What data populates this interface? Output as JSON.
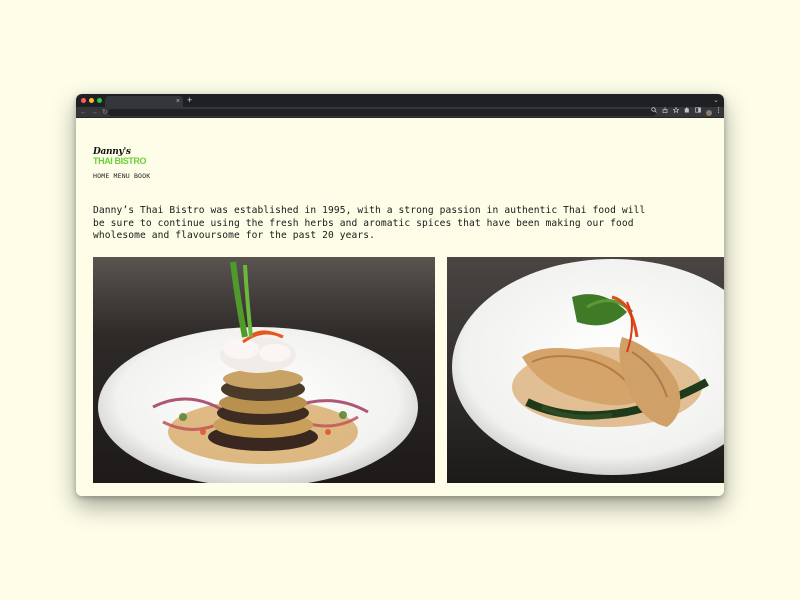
{
  "browser": {
    "tab_close_glyph": "×",
    "new_tab_glyph": "+",
    "tab_menu_glyph": "⌄",
    "nav_back_glyph": "←",
    "nav_forward_glyph": "→",
    "nav_reload_glyph": "↻",
    "toolbar_icons": [
      "zoom-icon",
      "share-icon",
      "star-icon",
      "extensions-icon",
      "sidebar-icon",
      "profile-avatar",
      "kebab-menu-icon"
    ]
  },
  "site": {
    "logo_script": "Danny's",
    "logo_brand": "THAI BISTRO",
    "brand_color": "#6ccf3a",
    "nav": [
      {
        "label": "HOME"
      },
      {
        "label": "MENU"
      },
      {
        "label": "BOOK"
      }
    ],
    "intro_text": "Danny’s Thai Bistro was established in 1995, with a strong passion in authentic Thai food will be sure to continue using the fresh herbs and aromatic spices that have been making our food wholesome and flavoursome for the past 20 years."
  },
  "colors": {
    "page_background": "#fdfde8",
    "chrome_dark": "#1f2023"
  }
}
